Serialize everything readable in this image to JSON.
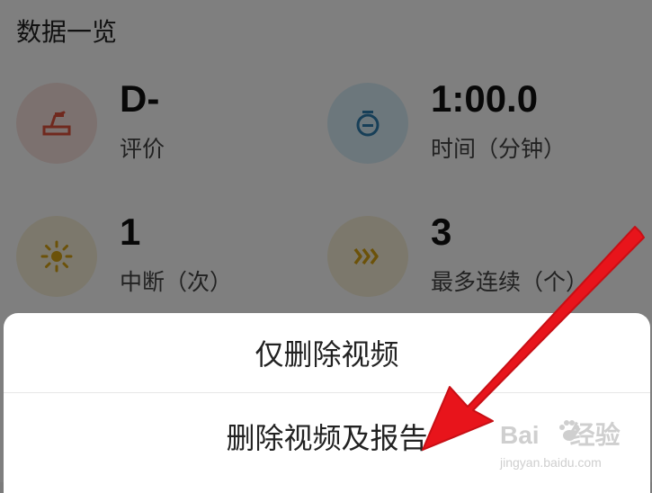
{
  "section_title": "数据一览",
  "stats": [
    {
      "value": "D-",
      "label": "评价",
      "icon": "rating-icon",
      "icon_bg": "#f9e2de",
      "icon_color": "#e1523d"
    },
    {
      "value": "1:00.0",
      "label": "时间（分钟）",
      "icon": "stopwatch-icon",
      "icon_bg": "#d9eef8",
      "icon_color": "#2f7fb1"
    },
    {
      "value": "1",
      "label": "中断（次）",
      "icon": "sun-icon",
      "icon_bg": "#f8f1d8",
      "icon_color": "#d9a412"
    },
    {
      "value": "3",
      "label": "最多连续（个）",
      "icon": "chevrons-icon",
      "icon_bg": "#f8f1d8",
      "icon_color": "#d9a412"
    }
  ],
  "sheet": {
    "option_delete_video": "仅删除视频",
    "option_delete_video_report": "删除视频及报告"
  },
  "watermark": {
    "main": "Bai",
    "main_after": "经验",
    "sub": "jingyan.baidu.com"
  },
  "colors": {
    "overlay": "rgba(0,0,0,0.5)",
    "arrow": "#e8141b"
  }
}
